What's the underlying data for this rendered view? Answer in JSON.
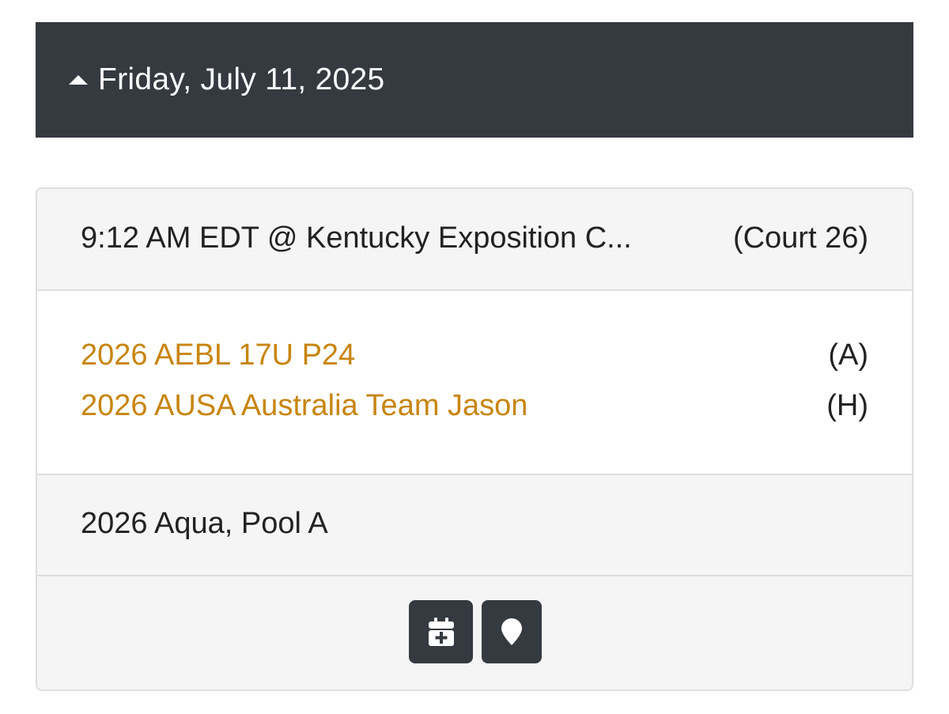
{
  "day_header": {
    "title": "Friday, July 11, 2025",
    "icon": "caret-up-icon"
  },
  "game": {
    "time_location": "9:12 AM EDT @ Kentucky Exposition C...",
    "court": "(Court 26)",
    "teams": [
      {
        "name": "2026 AEBL 17U P24",
        "side": "(A)"
      },
      {
        "name": "2026 AUSA Australia Team Jason",
        "side": "(H)"
      }
    ],
    "pool": "2026 Aqua, Pool A",
    "actions": [
      {
        "icon": "calendar-plus-icon"
      },
      {
        "icon": "map-marker-icon"
      }
    ]
  },
  "colors": {
    "header_bg": "#343a40",
    "team_link": "#c8850e",
    "card_bg": "#f5f5f5",
    "border": "#dedede"
  }
}
